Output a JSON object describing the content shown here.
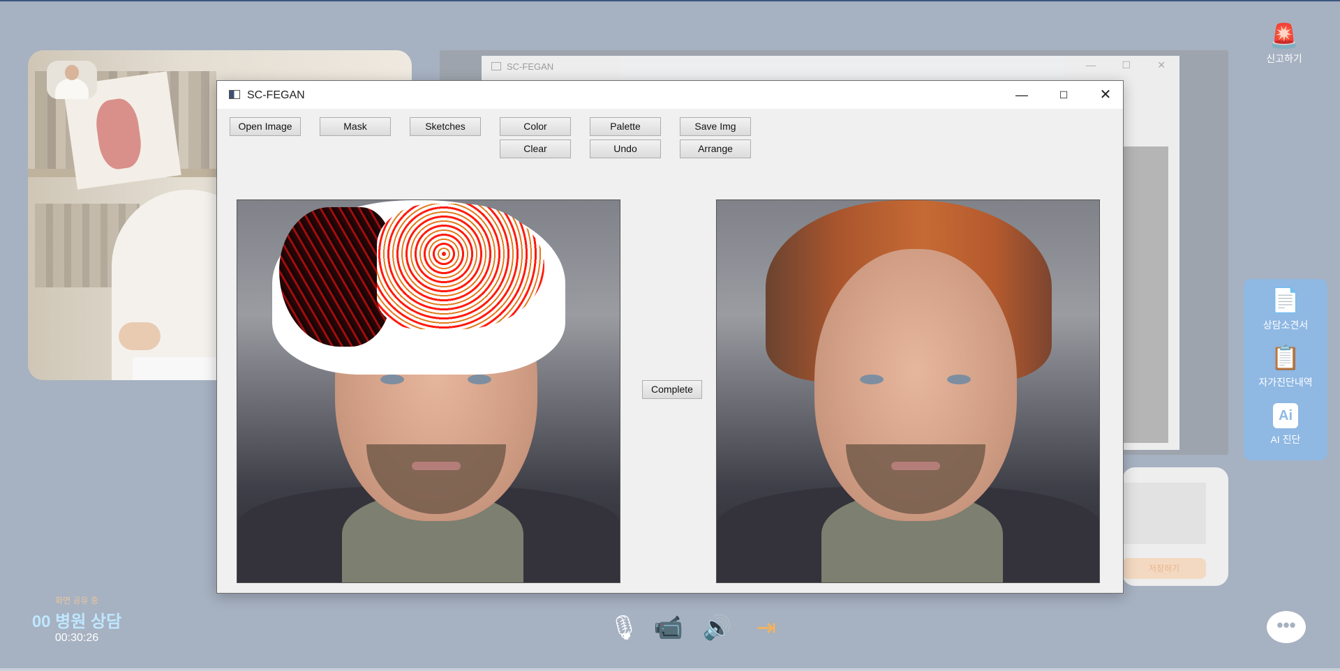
{
  "app": {
    "window_title": "SC-FEGAN",
    "background_window_title": "SC-FEGAN"
  },
  "toolbar": {
    "open_image": "Open Image",
    "mask": "Mask",
    "sketches": "Sketches",
    "color": "Color",
    "palette": "Palette",
    "save_img": "Save Img",
    "clear": "Clear",
    "undo": "Undo",
    "arrange": "Arrange"
  },
  "main": {
    "complete": "Complete"
  },
  "side": {
    "report": "신고하기",
    "items": [
      "상담소견서",
      "자가진단내역",
      "AI 진단"
    ],
    "ai_icon": "Ai"
  },
  "bg_card": {
    "save": "저장하기"
  },
  "session": {
    "sharing": "화면 공유 중",
    "title": "00 병원 상담",
    "timer": "00:30:26"
  },
  "icons": {
    "alarm": "siren-icon",
    "mic": "microphone-icon",
    "camera": "video-camera-icon",
    "speaker": "speaker-icon",
    "exit": "exit-icon",
    "chat": "chat-icon"
  },
  "colors": {
    "background": "#a6b1c1",
    "side_panel": "#8fb8e3",
    "exit": "#f5b35a",
    "alarm": "#f08f8a"
  }
}
